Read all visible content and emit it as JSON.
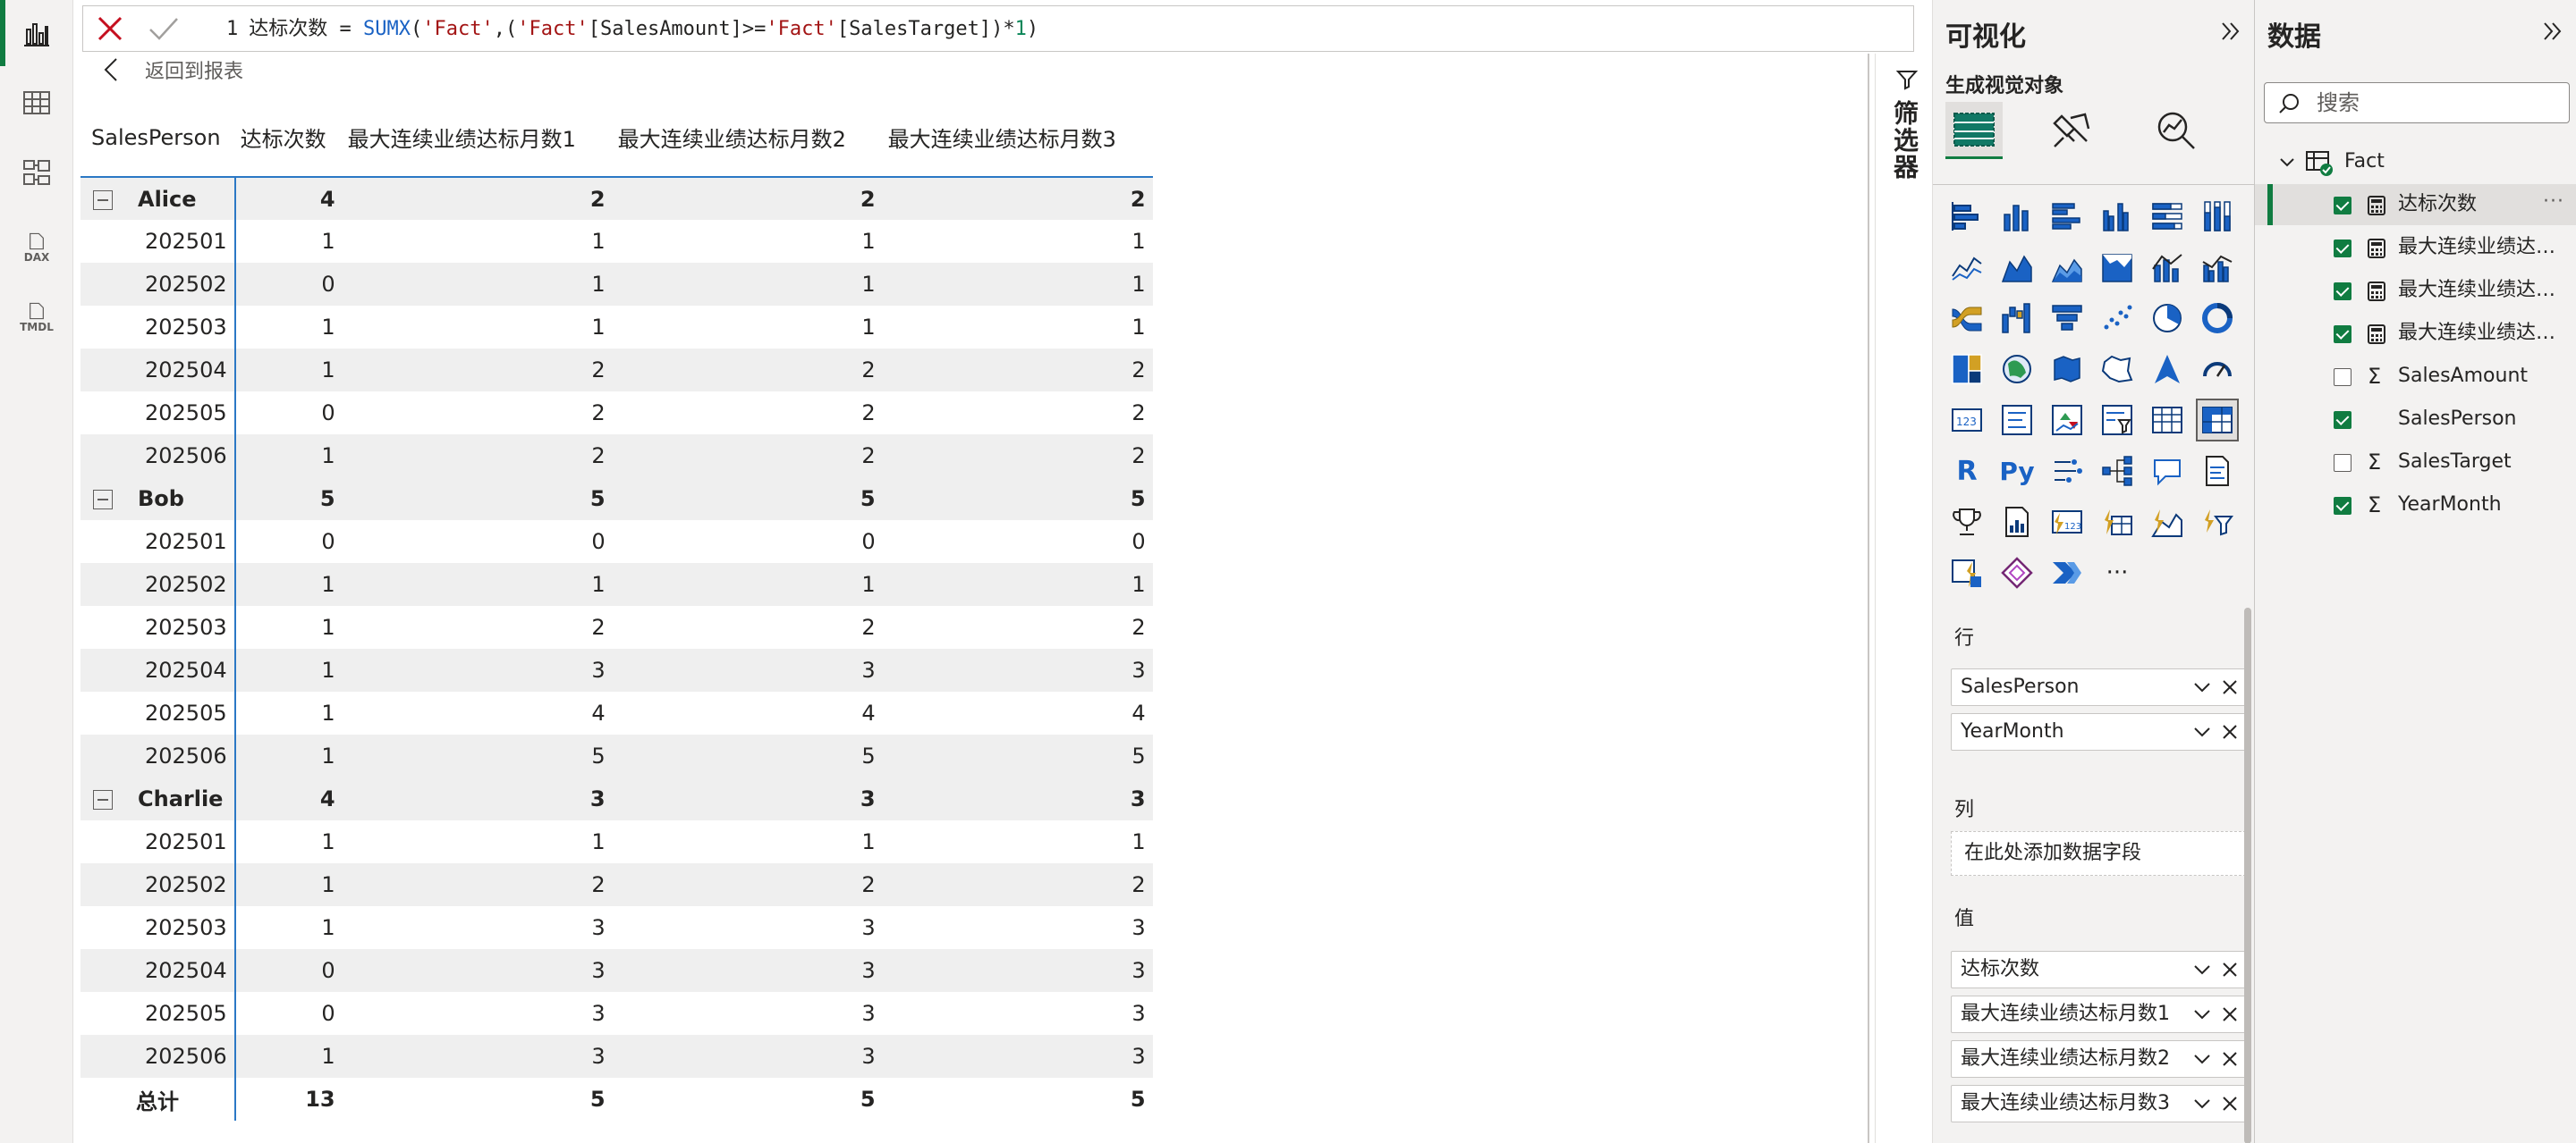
{
  "formula": {
    "line_no": "1",
    "measure_name": "达标次数",
    "eq": " = ",
    "fn": "SUMX",
    "p1": "(",
    "s1": "'Fact'",
    "p2": ",(",
    "s2": "'Fact'",
    "c1": "[SalesAmount]",
    "op": ">=",
    "s3": "'Fact'",
    "c2": "[SalesTarget]",
    "p3": ")*",
    "n1": "1",
    "p4": ")"
  },
  "back_label": "返回到报表",
  "rail": {
    "dax_label": "DAX",
    "tmdl_label": "TMDL"
  },
  "table": {
    "headers": [
      "SalesPerson",
      "达标次数",
      "最大连续业绩达标月数1",
      "最大连续业绩达标月数2",
      "最大连续业绩达标月数3"
    ],
    "groups": [
      {
        "name": "Alice",
        "totals": [
          "4",
          "2",
          "2",
          "2"
        ],
        "rows": [
          [
            "202501",
            "1",
            "1",
            "1",
            "1"
          ],
          [
            "202502",
            "0",
            "1",
            "1",
            "1"
          ],
          [
            "202503",
            "1",
            "1",
            "1",
            "1"
          ],
          [
            "202504",
            "1",
            "2",
            "2",
            "2"
          ],
          [
            "202505",
            "0",
            "2",
            "2",
            "2"
          ],
          [
            "202506",
            "1",
            "2",
            "2",
            "2"
          ]
        ]
      },
      {
        "name": "Bob",
        "totals": [
          "5",
          "5",
          "5",
          "5"
        ],
        "rows": [
          [
            "202501",
            "0",
            "0",
            "0",
            "0"
          ],
          [
            "202502",
            "1",
            "1",
            "1",
            "1"
          ],
          [
            "202503",
            "1",
            "2",
            "2",
            "2"
          ],
          [
            "202504",
            "1",
            "3",
            "3",
            "3"
          ],
          [
            "202505",
            "1",
            "4",
            "4",
            "4"
          ],
          [
            "202506",
            "1",
            "5",
            "5",
            "5"
          ]
        ]
      },
      {
        "name": "Charlie",
        "totals": [
          "4",
          "3",
          "3",
          "3"
        ],
        "rows": [
          [
            "202501",
            "1",
            "1",
            "1",
            "1"
          ],
          [
            "202502",
            "1",
            "2",
            "2",
            "2"
          ],
          [
            "202503",
            "1",
            "3",
            "3",
            "3"
          ],
          [
            "202504",
            "0",
            "3",
            "3",
            "3"
          ],
          [
            "202505",
            "0",
            "3",
            "3",
            "3"
          ],
          [
            "202506",
            "1",
            "3",
            "3",
            "3"
          ]
        ]
      }
    ],
    "total": {
      "label": "总计",
      "values": [
        "13",
        "5",
        "5",
        "5"
      ]
    }
  },
  "filters": {
    "label": "筛选器"
  },
  "viz": {
    "title": "可视化",
    "subtitle": "生成视觉对象",
    "r_label": "R",
    "py_label": "Py",
    "more_label": "···",
    "wells": {
      "rows_title": "行",
      "rows": [
        "SalesPerson",
        "YearMonth"
      ],
      "cols_title": "列",
      "cols_placeholder": "在此处添加数据字段",
      "values_title": "值",
      "values": [
        "达标次数",
        "最大连续业绩达标月数1",
        "最大连续业绩达标月数2",
        "最大连续业绩达标月数3"
      ]
    }
  },
  "data_pane": {
    "title": "数据",
    "search_placeholder": "搜索",
    "table_name": "Fact",
    "fields": [
      {
        "label": "达标次数",
        "checked": true,
        "kind": "measure"
      },
      {
        "label": "最大连续业绩达标月数1",
        "checked": true,
        "kind": "measure"
      },
      {
        "label": "最大连续业绩达标月数2",
        "checked": true,
        "kind": "measure"
      },
      {
        "label": "最大连续业绩达标月数3",
        "checked": true,
        "kind": "measure"
      },
      {
        "label": "SalesAmount",
        "checked": false,
        "kind": "sum"
      },
      {
        "label": "SalesPerson",
        "checked": true,
        "kind": "text"
      },
      {
        "label": "SalesTarget",
        "checked": false,
        "kind": "sum"
      },
      {
        "label": "YearMonth",
        "checked": true,
        "kind": "sum"
      }
    ],
    "more_label": "···"
  },
  "colors": {
    "accent": "#107c41",
    "grid_line": "#2b78c5",
    "row_shade": "#efefef",
    "cancel": "#c50f1f"
  }
}
